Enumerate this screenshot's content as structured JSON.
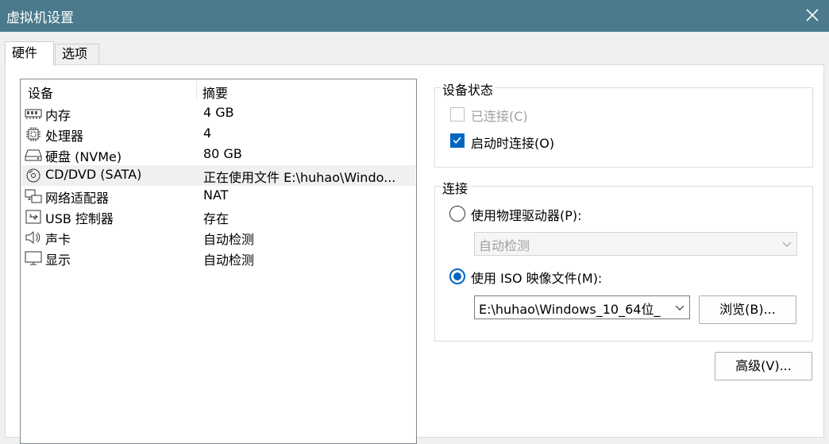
{
  "window": {
    "title": "虚拟机设置"
  },
  "tabs": [
    {
      "label": "硬件",
      "active": true
    },
    {
      "label": "选项",
      "active": false
    }
  ],
  "device_list": {
    "columns": [
      "设备",
      "摘要"
    ],
    "rows": [
      {
        "icon": "memory-icon",
        "name": "内存",
        "summary": "4 GB",
        "selected": false
      },
      {
        "icon": "processor-icon",
        "name": "处理器",
        "summary": "4",
        "selected": false
      },
      {
        "icon": "hard-disk-icon",
        "name": "硬盘 (NVMe)",
        "summary": "80 GB",
        "selected": false
      },
      {
        "icon": "cd-dvd-icon",
        "name": "CD/DVD (SATA)",
        "summary": "正在使用文件 E:\\huhao\\Windo...",
        "selected": true
      },
      {
        "icon": "network-adapter-icon",
        "name": "网络适配器",
        "summary": "NAT",
        "selected": false
      },
      {
        "icon": "usb-icon",
        "name": "USB 控制器",
        "summary": "存在",
        "selected": false
      },
      {
        "icon": "sound-card-icon",
        "name": "声卡",
        "summary": "自动检测",
        "selected": false
      },
      {
        "icon": "display-icon",
        "name": "显示",
        "summary": "自动检测",
        "selected": false
      }
    ]
  },
  "device_status": {
    "title": "设备状态",
    "connected_label": "已连接(C)",
    "connected_checked": false,
    "connected_disabled": true,
    "connect_at_power_on_label": "启动时连接(O)",
    "connect_at_power_on_checked": true
  },
  "connection": {
    "title": "连接",
    "physical_label": "使用物理驱动器(P):",
    "physical_selected": false,
    "physical_drive_value": "自动检测",
    "iso_label": "使用 ISO 映像文件(M):",
    "iso_selected": true,
    "iso_path": "E:\\huhao\\Windows_10_64位_",
    "browse_label": "浏览(B)..."
  },
  "advanced_label": "高级(V)...",
  "colors": {
    "titlebar": "#4a7a8c",
    "accent": "#0067c0"
  }
}
